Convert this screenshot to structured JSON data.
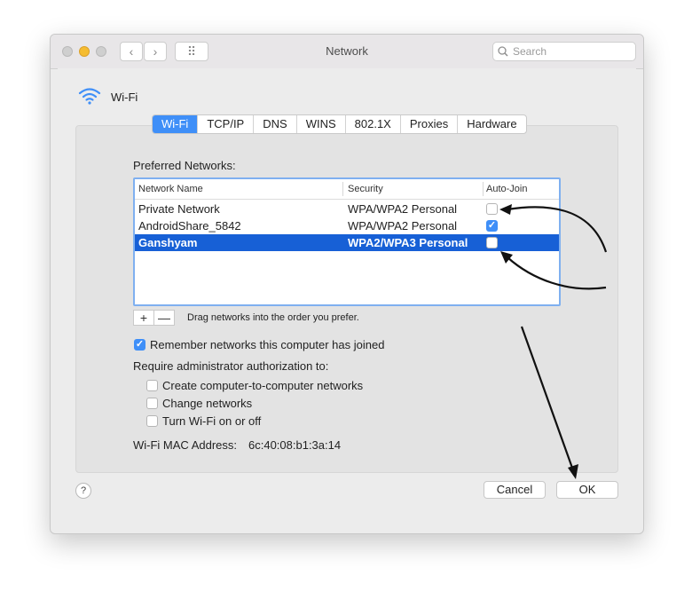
{
  "window": {
    "title": "Network"
  },
  "toolbar": {
    "back_icon": "‹",
    "forward_icon": "›",
    "grid_icon": "⠿",
    "search_placeholder": "Search"
  },
  "header": {
    "service_label": "Wi-Fi"
  },
  "tabs": [
    {
      "label": "Wi-Fi",
      "active": true
    },
    {
      "label": "TCP/IP"
    },
    {
      "label": "DNS"
    },
    {
      "label": "WINS"
    },
    {
      "label": "802.1X"
    },
    {
      "label": "Proxies"
    },
    {
      "label": "Hardware"
    }
  ],
  "preferred": {
    "label": "Preferred Networks:",
    "columns": [
      "Network Name",
      "Security",
      "Auto-Join"
    ],
    "rows": [
      {
        "name": "Private Network",
        "security": "WPA/WPA2 Personal",
        "auto_join": false
      },
      {
        "name": "AndroidShare_5842",
        "security": "WPA/WPA2 Personal",
        "auto_join": true
      },
      {
        "name": "Ganshyam",
        "security": "WPA2/WPA3 Personal",
        "auto_join": false,
        "selected": true
      }
    ],
    "add_label": "+",
    "remove_label": "—",
    "hint": "Drag networks into the order you prefer."
  },
  "options": {
    "remember_label": "Remember networks this computer has joined",
    "remember_checked": true,
    "require_label": "Require administrator authorization to:",
    "require_items": [
      {
        "label": "Create computer-to-computer networks",
        "checked": false
      },
      {
        "label": "Change networks",
        "checked": false
      },
      {
        "label": "Turn Wi-Fi on or off",
        "checked": false
      }
    ]
  },
  "mac": {
    "label": "Wi-Fi MAC Address:",
    "value": "6c:40:08:b1:3a:14"
  },
  "footer": {
    "help_label": "?",
    "cancel_label": "Cancel",
    "ok_label": "OK"
  },
  "colors": {
    "accent": "#3f8ff8",
    "selection": "#1760d6"
  }
}
